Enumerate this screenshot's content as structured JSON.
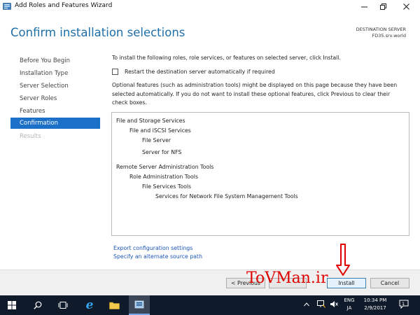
{
  "window": {
    "title": "Add Roles and Features Wizard",
    "icon": "server-manager-icon",
    "controls": [
      "minimize-icon",
      "maximize-icon",
      "close-icon"
    ]
  },
  "header": {
    "title": "Confirm installation selections",
    "destination_label": "DESTINATION SERVER",
    "destination_server": "FD35.srv.world"
  },
  "nav": {
    "items": [
      {
        "label": "Before You Begin",
        "state": "normal"
      },
      {
        "label": "Installation Type",
        "state": "normal"
      },
      {
        "label": "Server Selection",
        "state": "normal"
      },
      {
        "label": "Server Roles",
        "state": "normal"
      },
      {
        "label": "Features",
        "state": "normal"
      },
      {
        "label": "Confirmation",
        "state": "active"
      },
      {
        "label": "Results",
        "state": "disabled"
      }
    ]
  },
  "main": {
    "instruction": "To install the following roles, role services, or features on selected server, click Install.",
    "restart_checkbox": {
      "label": "Restart the destination server automatically if required",
      "checked": false
    },
    "optional_note": "Optional features (such as administration tools) might be displayed on this page because they have been selected automatically. If you do not want to install these optional features, click Previous to clear their check boxes.",
    "items": [
      {
        "text": "File and Storage Services",
        "level": 0
      },
      {
        "text": "File and iSCSI Services",
        "level": 1
      },
      {
        "text": "File Server",
        "level": 2
      },
      {
        "text": "Server for NFS",
        "level": 2
      },
      {
        "text": "Remote Server Administration Tools",
        "level": 0
      },
      {
        "text": "Role Administration Tools",
        "level": 1
      },
      {
        "text": "File Services Tools",
        "level": 2
      },
      {
        "text": "Services for Network File System Management Tools",
        "level": 3
      }
    ],
    "links": {
      "export": "Export configuration settings",
      "alternate_source": "Specify an alternate source path"
    }
  },
  "buttons": {
    "previous": "< Previous",
    "install": "Install",
    "cancel": "Cancel"
  },
  "watermark": "ToVMan.ir",
  "taskbar": {
    "icons": [
      "windows-start-icon",
      "search-icon",
      "task-view-icon",
      "internet-explorer-icon",
      "file-explorer-icon",
      "server-manager-icon"
    ],
    "tray": {
      "lang_top": "ENG",
      "lang_bottom": "JA",
      "time": "10:34 PM",
      "date": "2/9/2017",
      "notification_count": "1"
    }
  },
  "colors": {
    "accent": "#1c70c8",
    "title": "#1f6fa7",
    "link": "#1a55b8",
    "watermark": "#e00000",
    "taskbar": "#0f1a2a"
  }
}
